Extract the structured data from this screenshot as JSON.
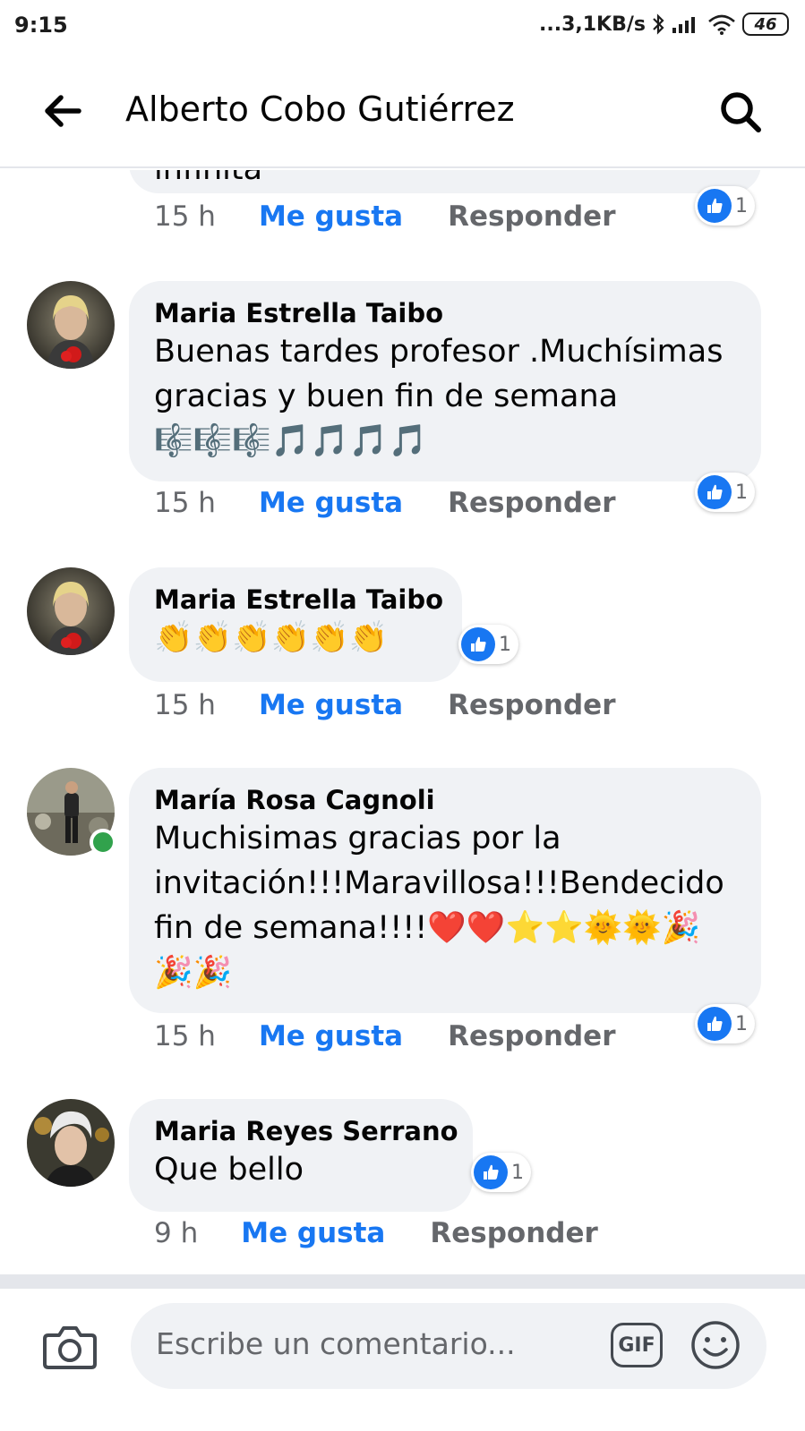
{
  "status_bar": {
    "time": "9:15",
    "network": "...3,1KB/s",
    "battery": "46"
  },
  "header": {
    "title": "Alberto Cobo Gutiérrez",
    "back_icon": "arrow-left-icon",
    "search_icon": "search-icon"
  },
  "comments": [
    {
      "author": "",
      "text": "infinita",
      "time": "15 h",
      "like_label": "Me gusta",
      "reply_label": "Responder",
      "reactions": "1"
    },
    {
      "author": "Maria Estrella Taibo",
      "text": "Buenas tardes profesor .Muchísimas gracias y buen fin de semana 🎼🎼🎼🎵🎵🎵🎵",
      "time": "15 h",
      "like_label": "Me gusta",
      "reply_label": "Responder",
      "reactions": "1"
    },
    {
      "author": "Maria Estrella Taibo",
      "text": "👏👏👏👏👏👏",
      "time": "15 h",
      "like_label": "Me gusta",
      "reply_label": "Responder",
      "reactions": "1"
    },
    {
      "author": "María Rosa Cagnoli",
      "text": "Muchisimas gracias por la invitación!!!Maravillosa!!!Bendecido fin de semana!!!!❤️❤️⭐⭐🌞🌞🎉🎉🎉",
      "time": "15 h",
      "like_label": "Me gusta",
      "reply_label": "Responder",
      "reactions": "1",
      "online": true
    },
    {
      "author": "Maria Reyes Serrano",
      "text": "Que bello",
      "time": "9 h",
      "like_label": "Me gusta",
      "reply_label": "Responder",
      "reactions": "1"
    }
  ],
  "composer": {
    "placeholder": "Escribe un comentario...",
    "gif_label": "GIF",
    "camera_icon": "camera-icon",
    "emoji_icon": "smiley-icon"
  },
  "colors": {
    "accent": "#1877f2",
    "bubble": "#f0f2f5",
    "secondary_text": "#65676b",
    "online": "#31a24c"
  }
}
